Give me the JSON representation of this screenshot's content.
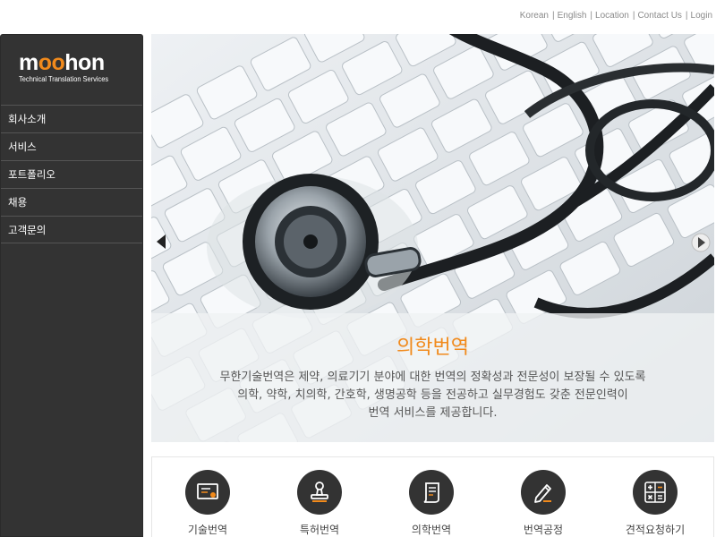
{
  "top_links": [
    "Korean",
    "English",
    "Location",
    "Contact Us",
    "Login"
  ],
  "logo": {
    "word_parts": [
      "m",
      "oo",
      "hon"
    ],
    "tagline": "Technical Translation Services"
  },
  "menu": [
    {
      "label": "회사소개"
    },
    {
      "label": "서비스"
    },
    {
      "label": "포트폴리오"
    },
    {
      "label": "채용"
    },
    {
      "label": "고객문의"
    }
  ],
  "hero": {
    "title": "의학번역",
    "description_lines": [
      "무한기술번역은 제약, 의료기기 분야에 대한 번역의 정확성과 전문성이 보장될 수 있도록",
      "의학, 약학, 치의학, 간호학, 생명공학 등을 전공하고 실무경험도 갖춘 전문인력이",
      "번역 서비스를 제공합니다."
    ]
  },
  "services": [
    {
      "label": "기술번역",
      "icon": "certificate-icon"
    },
    {
      "label": "특허번역",
      "icon": "stamp-icon"
    },
    {
      "label": "의학번역",
      "icon": "scroll-icon"
    },
    {
      "label": "번역공정",
      "icon": "pencil-icon"
    },
    {
      "label": "견적요청하기",
      "icon": "calculator-icon"
    }
  ],
  "colors": {
    "accent": "#f18a1c",
    "sidebar": "#333333",
    "icon_circle": "#333333"
  }
}
